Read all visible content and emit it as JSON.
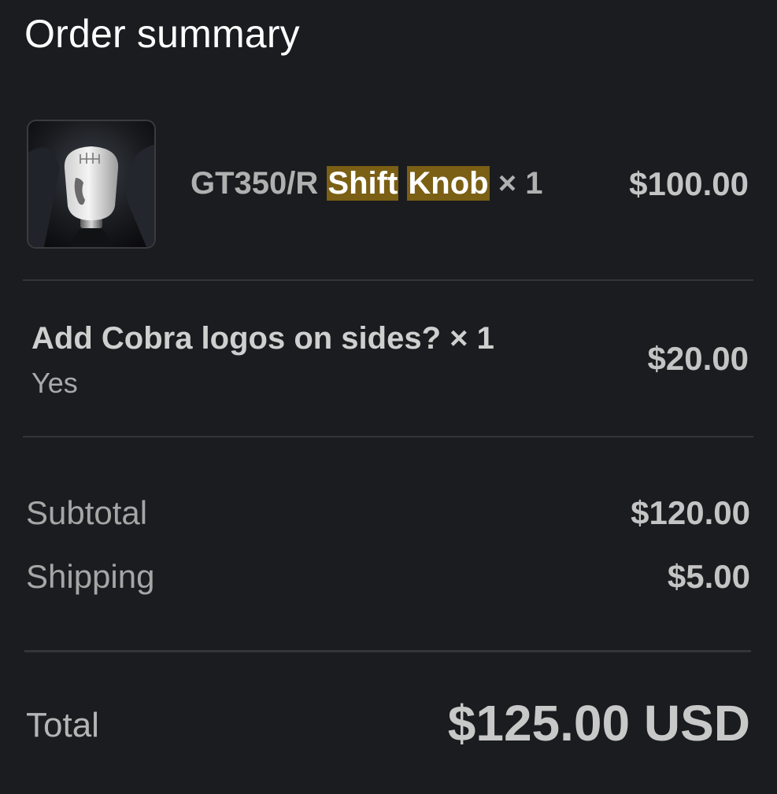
{
  "header": {
    "title": "Order summary"
  },
  "product": {
    "name_prefix": "GT350/R ",
    "name_highlight_1": "Shift",
    "name_highlight_2": "Knob",
    "quantity": "× 1",
    "price": "$100.00",
    "thumbnail_icon": "shift-knob-photo"
  },
  "addon": {
    "title": "Add Cobra logos on sides? × 1",
    "value": "Yes",
    "price": "$20.00"
  },
  "summary": {
    "subtotal_label": "Subtotal",
    "subtotal_value": "$120.00",
    "shipping_label": "Shipping",
    "shipping_value": "$5.00",
    "total_label": "Total",
    "total_value": "$125.00 USD"
  },
  "colors": {
    "background": "#1b1c1f",
    "highlight": "#7a5f14",
    "divider": "#34353a"
  }
}
